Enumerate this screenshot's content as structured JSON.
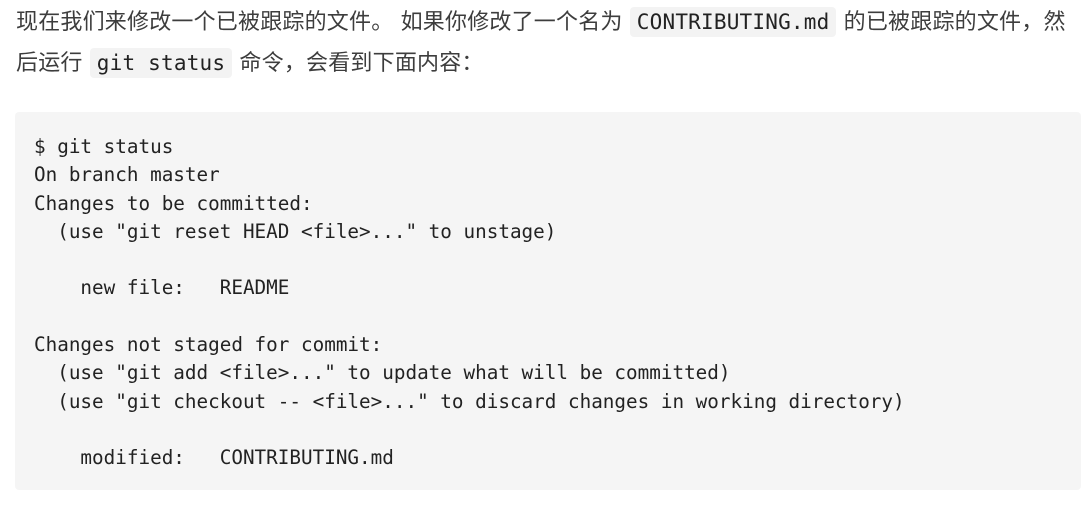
{
  "paragraph": {
    "text_before_first_code": "现在我们来修改一个已被跟踪的文件。 如果你修改了一个名为 ",
    "first_code": "CONTRIBUTING.md",
    "text_between": " 的已被跟踪的文件，然后运行 ",
    "second_code": "git status",
    "text_after": " 命令，会看到下面内容："
  },
  "code_block": {
    "lines": [
      "$ git status",
      "On branch master",
      "Changes to be committed:",
      "  (use \"git reset HEAD <file>...\" to unstage)",
      "",
      "    new file:   README",
      "",
      "Changes not staged for commit:",
      "  (use \"git add <file>...\" to update what will be committed)",
      "  (use \"git checkout -- <file>...\" to discard changes in working directory)",
      "",
      "    modified:   CONTRIBUTING.md"
    ]
  }
}
